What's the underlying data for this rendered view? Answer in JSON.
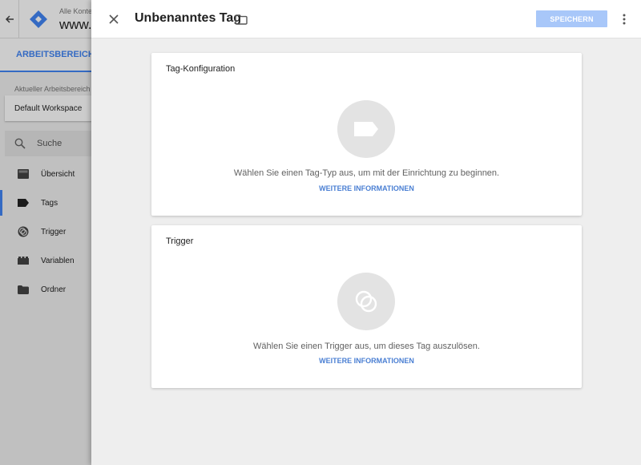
{
  "background": {
    "back_icon": "arrow-left-icon",
    "container_label": "Alle Konte",
    "container_name": "www.k",
    "tab_active": "ARBEITSBEREICH",
    "workspace_label": "Aktueller Arbeitsbereich",
    "workspace_value": "Default Workspace",
    "search_placeholder": "Suche",
    "nav": [
      {
        "label": "Übersicht",
        "icon": "overview-icon"
      },
      {
        "label": "Tags",
        "icon": "tag-icon"
      },
      {
        "label": "Trigger",
        "icon": "trigger-icon"
      },
      {
        "label": "Variablen",
        "icon": "variables-icon"
      },
      {
        "label": "Ordner",
        "icon": "folder-icon"
      }
    ],
    "nav_active_index": 1
  },
  "panel": {
    "title": "Unbenanntes Tag",
    "save_label": "SPEICHERN",
    "cards": [
      {
        "title": "Tag-Konfiguration",
        "text": "Wählen Sie einen Tag-Typ aus, um mit der Einrichtung zu beginnen.",
        "link": "WEITERE INFORMATIONEN",
        "icon": "tag-icon"
      },
      {
        "title": "Trigger",
        "text": "Wählen Sie einen Trigger aus, um dieses Tag auszulösen.",
        "link": "WEITERE INFORMATIONEN",
        "icon": "trigger-icon"
      }
    ]
  },
  "colors": {
    "accent": "#4285f4",
    "save_button_disabled": "#a8c7f9",
    "link": "#4a7fd3"
  }
}
